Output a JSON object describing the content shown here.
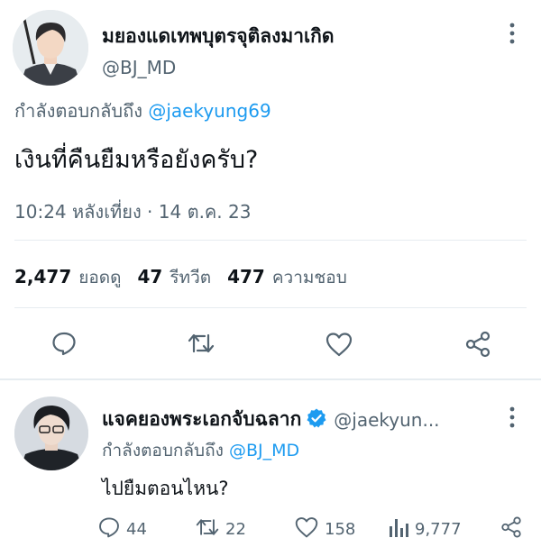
{
  "main_tweet": {
    "author_name": "มยองแดเทพบุตรจุติลงมาเกิด",
    "author_handle": "@BJ_MD",
    "reply_prefix": "กำลังตอบกลับถึง",
    "reply_to": "@jaekyung69",
    "text": "เงินที่คืนยืมหรือยังครับ?",
    "timestamp": "10:24 หลังเที่ยง · 14 ต.ค. 23",
    "stats": {
      "views": "2,477",
      "views_label": "ยอดดู",
      "retweets": "47",
      "retweets_label": "รีทวีต",
      "likes": "477",
      "likes_label": "ความชอบ"
    },
    "actions": [
      "comment-icon",
      "retweet-icon",
      "heart-icon",
      "share-icon"
    ]
  },
  "reply_tweet": {
    "author_name": "แจคยองพระเอกจับฉลาก",
    "verified": true,
    "author_handle": "@jaekyun...",
    "reply_prefix": "กำลังตอบกลับถึง",
    "reply_to": "@BJ_MD",
    "text": "ไปยืมตอนไหน?",
    "stats": {
      "comments": "44",
      "retweets": "22",
      "likes": "158",
      "views": "9,777"
    }
  },
  "colors": {
    "accent": "#1d9bf0",
    "text": "#0f1419",
    "muted": "#536471",
    "divider": "#e6ecf0"
  }
}
